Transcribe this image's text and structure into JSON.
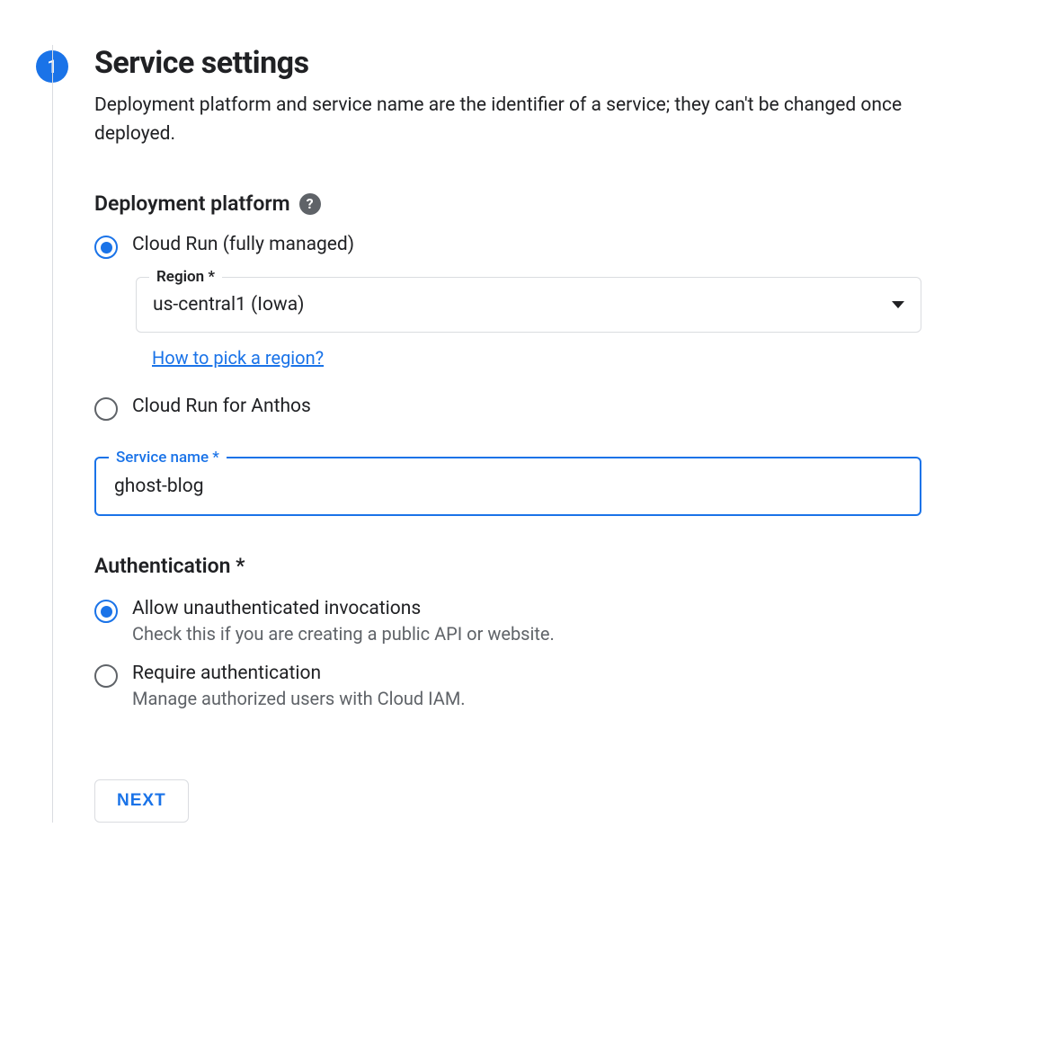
{
  "step": {
    "number": "1",
    "title": "Service settings",
    "description": "Deployment platform and service name are the identifier of a service; they can't be changed once deployed."
  },
  "deployment_platform": {
    "heading": "Deployment platform",
    "options": {
      "fully_managed": {
        "label": "Cloud Run (fully managed)",
        "selected": true
      },
      "anthos": {
        "label": "Cloud Run for Anthos",
        "selected": false
      }
    },
    "region": {
      "label": "Region *",
      "value": "us-central1 (Iowa)",
      "help_link": "How to pick a region?"
    }
  },
  "service_name": {
    "label": "Service name *",
    "value": "ghost-blog"
  },
  "authentication": {
    "heading": "Authentication *",
    "options": {
      "unauth": {
        "label": "Allow unauthenticated invocations",
        "hint": "Check this if you are creating a public API or website.",
        "selected": true
      },
      "require": {
        "label": "Require authentication",
        "hint": "Manage authorized users with Cloud IAM.",
        "selected": false
      }
    }
  },
  "buttons": {
    "next": "NEXT"
  }
}
